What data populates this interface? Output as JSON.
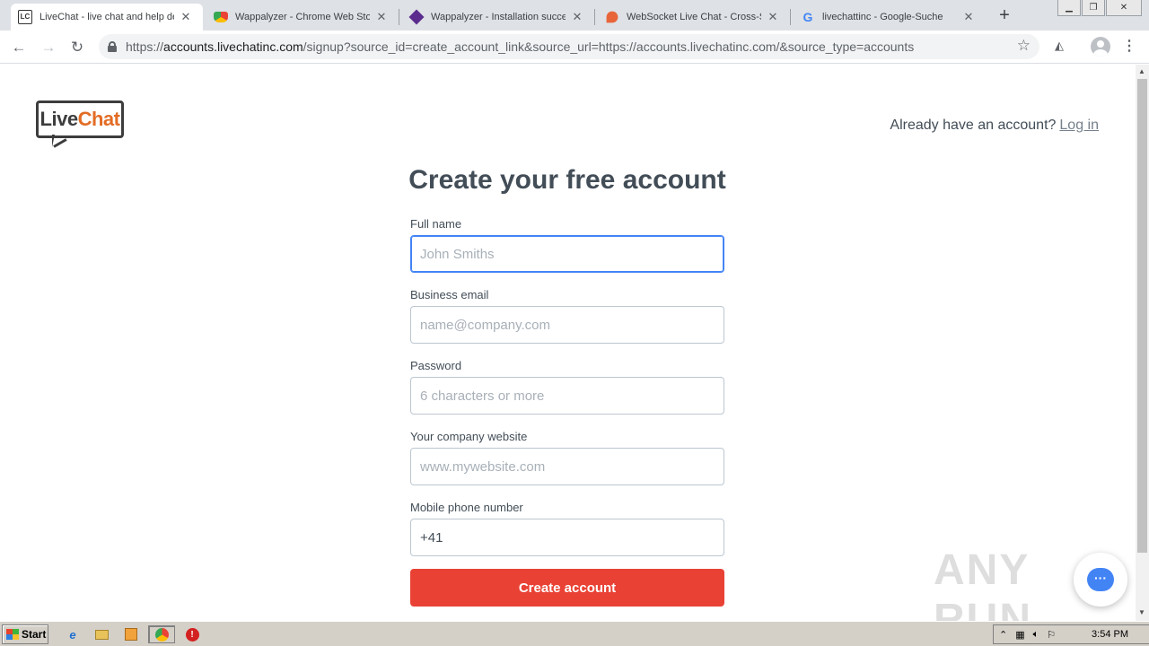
{
  "browser": {
    "tabs": [
      {
        "title": "LiveChat - live chat and help desk",
        "active": true,
        "favicon": "livechat-favicon"
      },
      {
        "title": "Wappalyzer - Chrome Web Store",
        "active": false,
        "favicon": "chrome-webstore-favicon"
      },
      {
        "title": "Wappalyzer - Installation successful",
        "active": false,
        "favicon": "wappalyzer-favicon"
      },
      {
        "title": "WebSocket Live Chat - Cross-Site",
        "active": false,
        "favicon": "websocket-favicon"
      },
      {
        "title": "livechattinc - Google-Suche",
        "active": false,
        "favicon": "google-favicon"
      }
    ],
    "new_tab_symbol": "+",
    "url_scheme": "https://",
    "url_host": "accounts.livechatinc.com",
    "url_path": "/signup?source_id=create_account_link&source_url=https://accounts.livechatinc.com/&source_type=accounts"
  },
  "page": {
    "logo_live": "Live",
    "logo_chat": "Chat",
    "already_text": "Already have an account?",
    "login_link": "Log in",
    "title": "Create your free account",
    "fields": [
      {
        "label": "Full name",
        "placeholder": "John Smiths",
        "value": "",
        "focused": true
      },
      {
        "label": "Business email",
        "placeholder": "name@company.com",
        "value": ""
      },
      {
        "label": "Password",
        "placeholder": "6 characters or more",
        "value": ""
      },
      {
        "label": "Your company website",
        "placeholder": "www.mywebsite.com",
        "value": ""
      },
      {
        "label": "Mobile phone number",
        "placeholder": "",
        "value": "+41"
      }
    ],
    "submit_label": "Create account",
    "watermark": "ANY RUN"
  },
  "taskbar": {
    "start_label": "Start",
    "clock": "3:54 PM"
  }
}
